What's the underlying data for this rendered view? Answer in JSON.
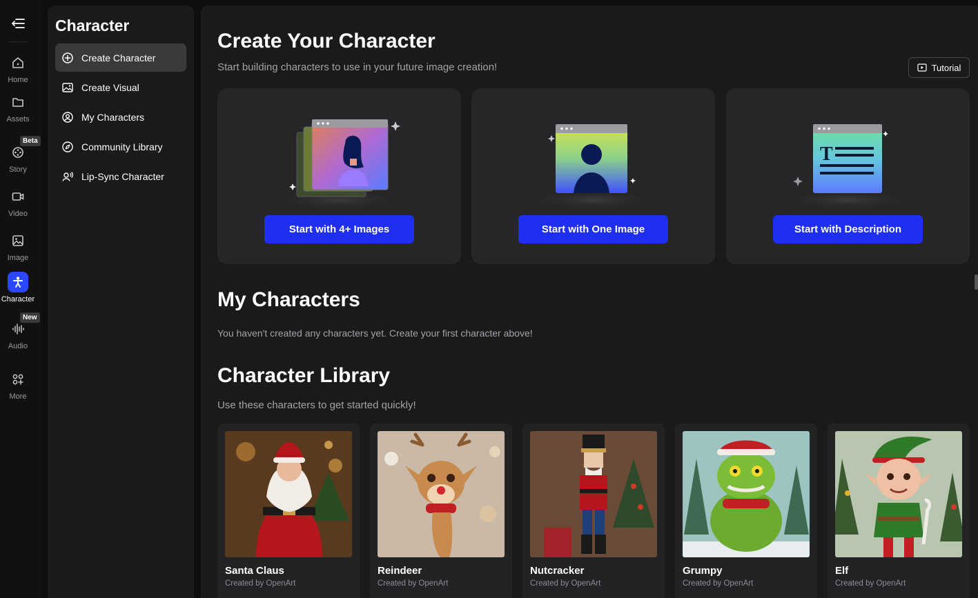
{
  "rail": {
    "items": [
      {
        "label": "Home",
        "icon": "home-icon"
      },
      {
        "label": "Assets",
        "icon": "folder-icon"
      },
      {
        "label": "Story",
        "icon": "film-reel-icon",
        "badge": "Beta"
      },
      {
        "label": "Video",
        "icon": "video-icon"
      },
      {
        "label": "Image",
        "icon": "image-icon"
      },
      {
        "label": "Character",
        "icon": "character-icon",
        "active": true
      },
      {
        "label": "Audio",
        "icon": "waveform-icon",
        "badge": "New"
      },
      {
        "label": "More",
        "icon": "grid-plus-icon"
      }
    ]
  },
  "sidebar": {
    "title": "Character",
    "items": [
      {
        "label": "Create Character",
        "icon": "plus-circle-icon",
        "active": true
      },
      {
        "label": "Create Visual",
        "icon": "image-stack-icon"
      },
      {
        "label": "My Characters",
        "icon": "user-circle-icon"
      },
      {
        "label": "Community Library",
        "icon": "compass-icon"
      },
      {
        "label": "Lip-Sync Character",
        "icon": "voice-user-icon"
      }
    ]
  },
  "main": {
    "title": "Create Your Character",
    "subtitle": "Start building characters to use in your future image creation!",
    "tutorial_label": "Tutorial",
    "create_options": [
      {
        "button": "Start with 4+ Images",
        "art": "multi-image-art"
      },
      {
        "button": "Start with One Image",
        "art": "single-image-art"
      },
      {
        "button": "Start with Description",
        "art": "text-description-art"
      }
    ],
    "my_characters": {
      "title": "My Characters",
      "empty_text": "You haven't created any characters yet. Create your first character above!"
    },
    "library": {
      "title": "Character Library",
      "subtitle": "Use these characters to get started quickly!",
      "items": [
        {
          "name": "Santa Claus",
          "by": "Created by OpenArt"
        },
        {
          "name": "Reindeer",
          "by": "Created by OpenArt"
        },
        {
          "name": "Nutcracker",
          "by": "Created by OpenArt"
        },
        {
          "name": "Grumpy",
          "by": "Created by OpenArt"
        },
        {
          "name": "Elf",
          "by": "Created by OpenArt"
        }
      ]
    }
  },
  "colors": {
    "accent": "#1f2ff0",
    "active_rail": "#2b47ff",
    "background": "#0e0e0f",
    "panel": "#1a1a1b",
    "card": "#262628"
  }
}
